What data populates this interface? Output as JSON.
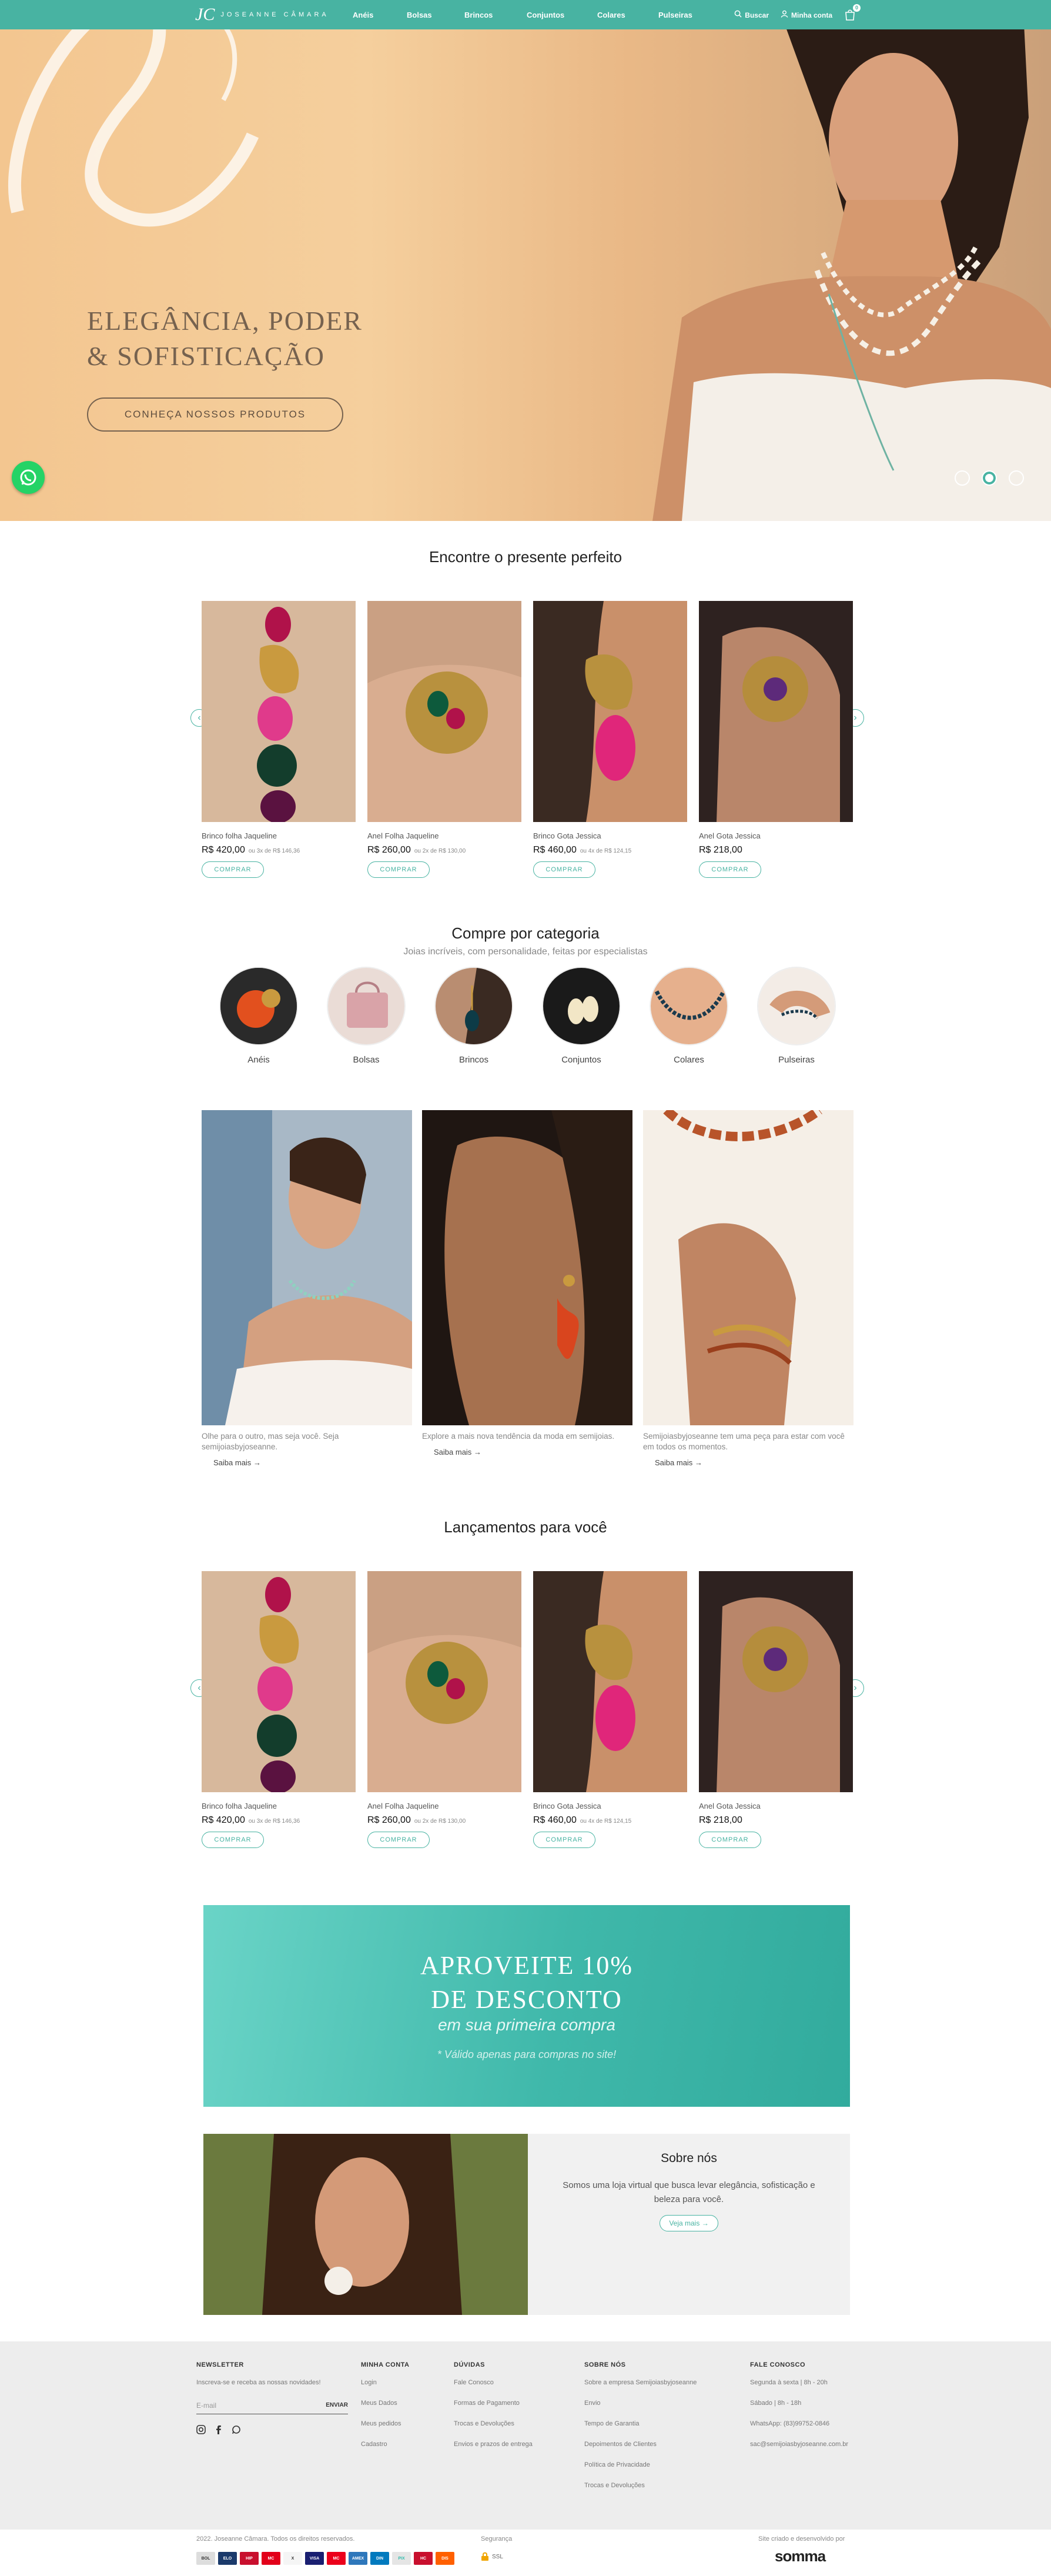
{
  "header": {
    "logo_text": "JOSEANNE CÂMARA",
    "nav": [
      "Anéis",
      "Bolsas",
      "Brincos",
      "Conjuntos",
      "Colares",
      "Pulseiras"
    ],
    "search_label": "Buscar",
    "account_label": "Minha conta",
    "cart_count": "0"
  },
  "hero": {
    "title_line1": "ELEGÂNCIA, PODER",
    "title_line2": "& SOFISTICAÇÃO",
    "cta": "CONHEÇA NOSSOS PRODUTOS",
    "slide_count": 3,
    "active_slide": 2
  },
  "gift_section": {
    "title": "Encontre o presente perfeito",
    "products": [
      {
        "name": "Brinco folha Jaqueline",
        "price": "R$ 420,00",
        "installments": "ou 3x de R$ 146,36",
        "buy": "COMPRAR"
      },
      {
        "name": "Anel Folha Jaqueline",
        "price": "R$ 260,00",
        "installments": "ou 2x de R$ 130,00",
        "buy": "COMPRAR"
      },
      {
        "name": "Brinco Gota Jessica",
        "price": "R$ 460,00",
        "installments": "ou 4x de R$ 124,15",
        "buy": "COMPRAR"
      },
      {
        "name": "Anel Gota Jessica",
        "price": "R$ 218,00",
        "installments": "",
        "buy": "COMPRAR"
      }
    ]
  },
  "category_section": {
    "title": "Compre por categoria",
    "subtitle": "Joias incríveis, com personalidade, feitas por especialistas",
    "categories": [
      "Anéis",
      "Bolsas",
      "Brincos",
      "Conjuntos",
      "Colares",
      "Pulseiras"
    ]
  },
  "features": [
    {
      "text": "Olhe para o outro, mas seja você. Seja semijoiasbyjoseanne.",
      "more": "Saiba mais"
    },
    {
      "text": "Explore a mais nova tendência da moda em semijoias.",
      "more": "Saiba mais"
    },
    {
      "text": "Semijoiasbyjoseanne tem uma peça para estar com você em todos os momentos.",
      "more": "Saiba mais"
    }
  ],
  "launch_section": {
    "title": "Lançamentos para você",
    "products": [
      {
        "name": "Brinco folha Jaqueline",
        "price": "R$ 420,00",
        "installments": "ou 3x de R$ 146,36",
        "buy": "COMPRAR"
      },
      {
        "name": "Anel Folha Jaqueline",
        "price": "R$ 260,00",
        "installments": "ou 2x de R$ 130,00",
        "buy": "COMPRAR"
      },
      {
        "name": "Brinco Gota Jessica",
        "price": "R$ 460,00",
        "installments": "ou 4x de R$ 124,15",
        "buy": "COMPRAR"
      },
      {
        "name": "Anel Gota Jessica",
        "price": "R$ 218,00",
        "installments": "",
        "buy": "COMPRAR"
      }
    ]
  },
  "promo": {
    "line1": "APROVEITE 10%",
    "line2": "DE DESCONTO",
    "line3": "em sua primeira compra",
    "note": "* Válido apenas para compras no site!"
  },
  "about": {
    "title": "Sobre nós",
    "description": "Somos uma loja virtual que busca levar elegância, sofisticação e beleza para você.",
    "button": "Veja mais"
  },
  "footer": {
    "newsletter_title": "NEWSLETTER",
    "newsletter_desc": "Inscreva-se e receba as nossas novidades!",
    "email_placeholder": "E-mail",
    "send": "ENVIAR",
    "columns": [
      {
        "title": "MINHA CONTA",
        "items": [
          "Login",
          "Meus Dados",
          "Meus pedidos",
          "Cadastro"
        ]
      },
      {
        "title": "DÚVIDAS",
        "items": [
          "Fale Conosco",
          "Formas de Pagamento",
          "Trocas e Devoluções",
          "Envios e prazos de entrega"
        ]
      },
      {
        "title": "SOBRE NÓS",
        "items": [
          "Sobre a empresa Semijoiasbyjoseanne",
          "Envio",
          "Tempo de Garantia",
          "Depoimentos de Clientes",
          "Política de Privacidade",
          "Trocas e Devoluções"
        ]
      },
      {
        "title": "FALE CONOSCO",
        "items": [
          "Segunda à sexta | 8h - 20h",
          "Sábado | 8h - 18h",
          "WhatsApp: (83)99752-0846",
          "sac@semijoiasbyjoseanne.com.br"
        ]
      }
    ]
  },
  "bottom": {
    "copyright": "2022. Joseanne Câmara. Todos os direitos reservados.",
    "security": "Segurança",
    "ssl": "SSL",
    "developed": "Site criado e desenvolvido por",
    "dev_brand": "somma",
    "payments": [
      "BOL",
      "ELO",
      "HIP",
      "MC",
      "X",
      "VISA",
      "MC",
      "AMEX",
      "DIN",
      "PIX",
      "HC",
      "DIS"
    ]
  },
  "colors": {
    "accent": "#48b3a2",
    "hero_text": "#76624f"
  }
}
